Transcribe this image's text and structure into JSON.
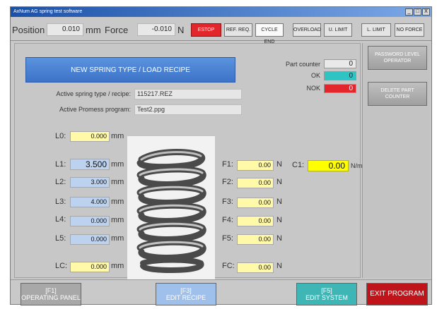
{
  "window": {
    "title": "AxNum AG spring test software",
    "controls": [
      "_",
      "□",
      "X"
    ]
  },
  "status": {
    "position_label": "Position",
    "position_value": "0.010",
    "position_unit": "mm",
    "force_label": "Force",
    "force_value": "-0.010",
    "force_unit": "N",
    "flags": [
      {
        "label": "ESTOP",
        "state": "active",
        "color": "#e3262b"
      },
      {
        "label": "REF. REQ.",
        "state": "inactive"
      },
      {
        "label": "CYCLE END",
        "state": "highlight"
      },
      {
        "label": "OVERLOAD",
        "state": "inactive"
      },
      {
        "label": "U. LIMIT",
        "state": "inactive"
      },
      {
        "label": "L. LIMIT",
        "state": "inactive"
      },
      {
        "label": "NO FORCE",
        "state": "inactive"
      }
    ]
  },
  "recipe": {
    "new_button_label": "NEW SPRING TYPE / LOAD RECIPE",
    "active_type_label": "Active spring type / recipe:",
    "active_type_value": "115217.REZ",
    "promess_label": "Active Promess program:",
    "promess_value": "Test2.ppg"
  },
  "counters": {
    "part_counter_label": "Part counter",
    "part_counter_value": "0",
    "ok_label": "OK",
    "ok_value": "0",
    "ok_color": "#2ec4c4",
    "nok_label": "NOK",
    "nok_value": "0",
    "nok_color": "#e3262b"
  },
  "side": {
    "password_button_label": "PASSWORD LEVEL OPERATOR",
    "delete_button_label": "DELETE PART COUNTER"
  },
  "lengths": [
    {
      "label": "L0:",
      "value": "0.000",
      "unit": "mm",
      "style": "yellow"
    },
    {
      "label": "L1:",
      "value": "3.500",
      "unit": "mm",
      "style": "blue"
    },
    {
      "label": "L2:",
      "value": "3.000",
      "unit": "mm",
      "style": "blue"
    },
    {
      "label": "L3:",
      "value": "4.000",
      "unit": "mm",
      "style": "blue"
    },
    {
      "label": "L4:",
      "value": "0.000",
      "unit": "mm",
      "style": "blue"
    },
    {
      "label": "L5:",
      "value": "0.000",
      "unit": "mm",
      "style": "blue"
    },
    {
      "label": "LC:",
      "value": "0.000",
      "unit": "mm",
      "style": "yellow"
    }
  ],
  "forces": [
    {
      "label": "F1:",
      "value": "0.00",
      "unit": "N"
    },
    {
      "label": "F2:",
      "value": "0.00",
      "unit": "N"
    },
    {
      "label": "F3:",
      "value": "0.00",
      "unit": "N"
    },
    {
      "label": "F4:",
      "value": "0.00",
      "unit": "N"
    },
    {
      "label": "F5:",
      "value": "0.00",
      "unit": "N"
    },
    {
      "label": "FC:",
      "value": "0.00",
      "unit": "N"
    }
  ],
  "stiffness": {
    "label": "C1:",
    "value": "0.00",
    "unit": "N/mm"
  },
  "function_keys": [
    {
      "key": "[F1]",
      "label": "OPERATING PANEL",
      "color": "#a8a8a8"
    },
    {
      "key": "[F3]",
      "label": "EDIT RECIPE",
      "color": "#9fc0ea"
    },
    {
      "key": "[F5]",
      "label": "EDIT SYSTEM",
      "color": "#3fb6b6"
    },
    {
      "key": "",
      "label": "EXIT PROGRAM",
      "color": "#c0141b"
    }
  ]
}
